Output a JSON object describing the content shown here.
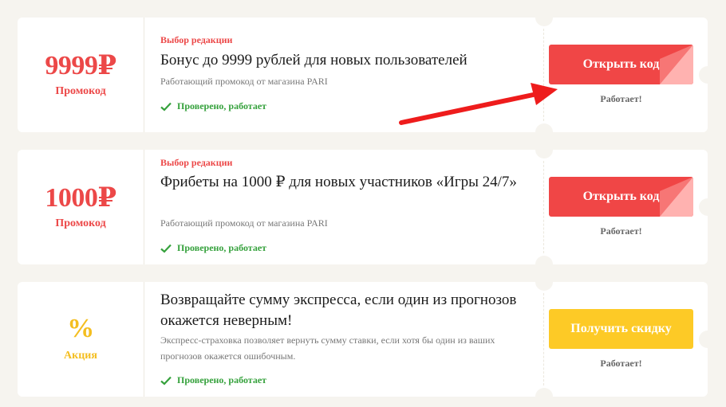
{
  "offers": [
    {
      "amount": "9999₽",
      "type_label": "Промокод",
      "editor_badge": "Выбор редакции",
      "title": "Бонус до 9999 рублей для новых пользователей",
      "description": "Работающий промокод от магазина PARI",
      "verified": "Проверено, работает",
      "button_label": "Открыть код",
      "status": "Работает!"
    },
    {
      "amount": "1000₽",
      "type_label": "Промокод",
      "editor_badge": "Выбор редакции",
      "title": "Фрибеты на 1000 ₽ для новых участников «Игры 24/7»",
      "description": "Работающий промокод от магазина PARI",
      "verified": "Проверено, работает",
      "button_label": "Открыть код",
      "status": "Работает!"
    },
    {
      "amount": "%",
      "type_label": "Акция",
      "title": "Возвращайте сумму экспресса, если один из прогнозов окажется неверным!",
      "description": "Экспресс-страховка позволяет вернуть сумму ставки, если хотя бы один из ваших прогнозов окажется ошибочным.",
      "verified": "Проверено, работает",
      "button_label": "Получить скидку",
      "status": "Работает!"
    }
  ],
  "colors": {
    "accent_red": "#ec4848",
    "accent_yellow": "#f4be20",
    "verified_green": "#35a13c",
    "button_red": "#f04646",
    "button_yellow": "#fdca26",
    "page_bg": "#f6f4ef"
  },
  "icons": {
    "verified": "check-icon",
    "annotation": "red-arrow-icon"
  }
}
